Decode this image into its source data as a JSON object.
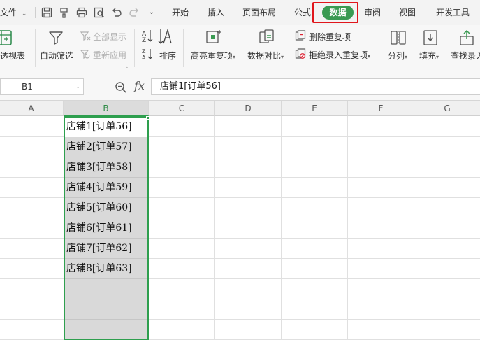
{
  "menubar": {
    "file_label": "文件",
    "tabs": [
      "开始",
      "插入",
      "页面布局",
      "公式",
      "数据",
      "审阅",
      "视图",
      "开发工具"
    ],
    "active_tab": "数据"
  },
  "ribbon": {
    "pivot_label": "透视表",
    "autofilter_label": "自动筛选",
    "show_all_label": "全部显示",
    "reapply_label": "重新应用",
    "sort_label": "排序",
    "highlight_dup_label": "高亮重复项",
    "compare_label": "数据对比",
    "remove_dup_label": "删除重复项",
    "reject_dup_label": "拒绝录入重复项",
    "split_label": "分列",
    "fill_label": "填充",
    "find_entry_label": "查找录入"
  },
  "formula_bar": {
    "cell_ref": "B1",
    "fx_label": "fx",
    "content": "店铺1[订单56]"
  },
  "sheet": {
    "columns": [
      "A",
      "B",
      "C",
      "D",
      "E",
      "F",
      "G"
    ],
    "active_column": "B",
    "column_b_cells": [
      "店铺1[订单56]",
      "店铺2[订单57]",
      "店铺3[订单58]",
      "店铺4[订单59]",
      "店铺5[订单60]",
      "店铺6[订单61]",
      "店铺7[订单62]",
      "店铺8[订单63]"
    ]
  }
}
